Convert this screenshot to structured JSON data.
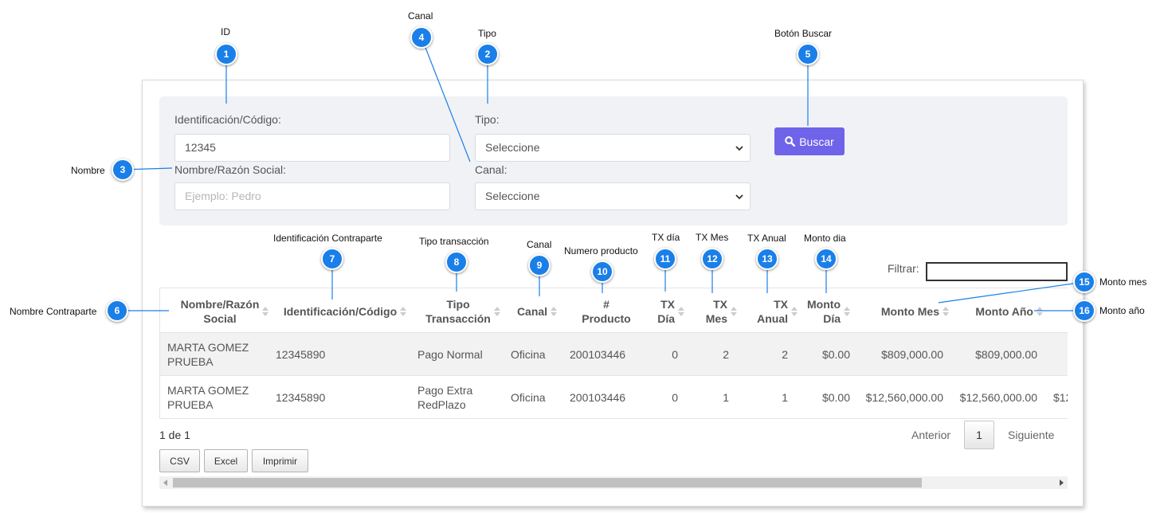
{
  "filters": {
    "id_label": "Identificación/Código:",
    "id_value": "12345",
    "tipo_label": "Tipo:",
    "tipo_value": "Seleccione",
    "nombre_label": "Nombre/Razón Social:",
    "nombre_placeholder": "Ejemplo: Pedro",
    "canal_label": "Canal:",
    "canal_value": "Seleccione",
    "search_label": "Buscar",
    "search_icon": "search-icon"
  },
  "table_filter": {
    "label": "Filtrar:"
  },
  "table": {
    "headers": [
      {
        "line1": "Nombre/Razón",
        "line2": "Social"
      },
      {
        "line1": "Identificación/Código",
        "line2": ""
      },
      {
        "line1": "Tipo",
        "line2": "Transacción"
      },
      {
        "line1": "Canal",
        "line2": ""
      },
      {
        "line1": "#",
        "line2": "Producto"
      },
      {
        "line1": "TX",
        "line2": "Día"
      },
      {
        "line1": "TX",
        "line2": "Mes"
      },
      {
        "line1": "TX",
        "line2": "Anual"
      },
      {
        "line1": "Monto",
        "line2": "Día"
      },
      {
        "line1": "Monto Mes",
        "line2": ""
      },
      {
        "line1": "Monto Año",
        "line2": ""
      }
    ],
    "rows": [
      {
        "nombre1": "MARTA GOMEZ",
        "nombre2": "PRUEBA",
        "identificacion": "12345890",
        "tipo1": "Pago Normal",
        "tipo2": "",
        "canal": "Oficina",
        "producto": "200103446",
        "tx_dia": "0",
        "tx_mes": "2",
        "tx_anual": "2",
        "monto_dia": "$0.00",
        "monto_mes": "$809,000.00",
        "monto_anio": "$809,000.00",
        "overflow": ""
      },
      {
        "nombre1": "MARTA GOMEZ",
        "nombre2": "PRUEBA",
        "identificacion": "12345890",
        "tipo1": "Pago Extra",
        "tipo2": "RedPlazo",
        "canal": "Oficina",
        "producto": "200103446",
        "tx_dia": "0",
        "tx_mes": "1",
        "tx_anual": "1",
        "monto_dia": "$0.00",
        "monto_mes": "$12,560,000.00",
        "monto_anio": "$12,560,000.00",
        "overflow": "$12"
      }
    ]
  },
  "pagination": {
    "info": "1 de 1",
    "prev": "Anterior",
    "page": "1",
    "next": "Siguiente"
  },
  "export": {
    "csv": "CSV",
    "excel": "Excel",
    "print": "Imprimir"
  },
  "annotations": [
    {
      "num": "1",
      "label": "ID"
    },
    {
      "num": "2",
      "label": "Tipo"
    },
    {
      "num": "3",
      "label": "Nombre"
    },
    {
      "num": "4",
      "label": "Canal"
    },
    {
      "num": "5",
      "label": "Botón  Buscar"
    },
    {
      "num": "6",
      "label": "Nombre Contraparte"
    },
    {
      "num": "7",
      "label": "Identificación Contraparte"
    },
    {
      "num": "8",
      "label": "Tipo transacción"
    },
    {
      "num": "9",
      "label": "Canal"
    },
    {
      "num": "10",
      "label": "Numero producto"
    },
    {
      "num": "11",
      "label": "TX día"
    },
    {
      "num": "12",
      "label": "TX Mes"
    },
    {
      "num": "13",
      "label": "TX Anual"
    },
    {
      "num": "14",
      "label": "Monto dia"
    },
    {
      "num": "15",
      "label": "Monto mes"
    },
    {
      "num": "16",
      "label": "Monto año"
    }
  ],
  "colors": {
    "badge": "#1a7fe8",
    "button": "#6f63ea",
    "filter_bg": "#f1f2f6"
  }
}
